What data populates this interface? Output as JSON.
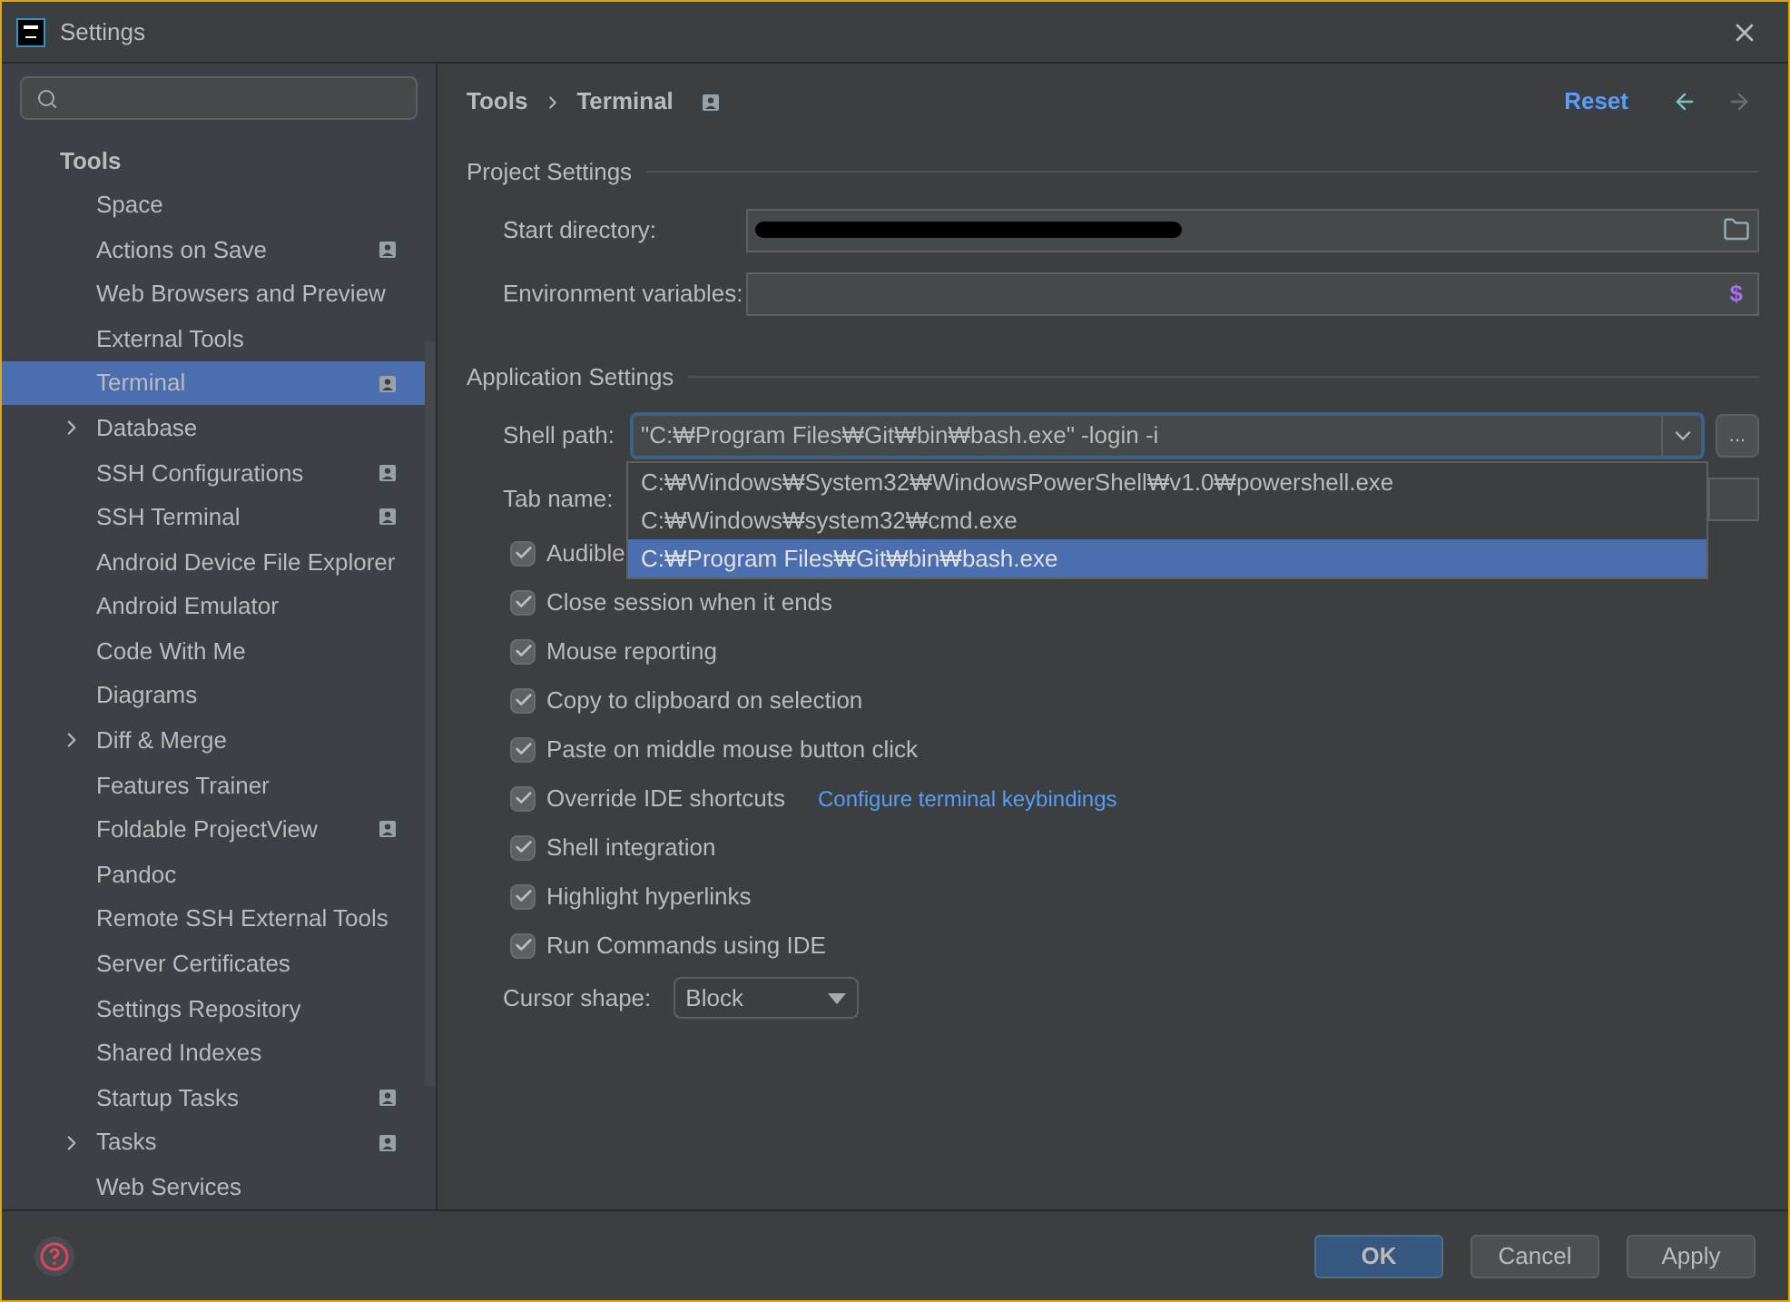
{
  "window": {
    "title": "Settings"
  },
  "sidebar": {
    "group": "Tools",
    "items": [
      {
        "label": "Space",
        "selected": false,
        "expandable": false,
        "project_level": false
      },
      {
        "label": "Actions on Save",
        "selected": false,
        "expandable": false,
        "project_level": true
      },
      {
        "label": "Web Browsers and Preview",
        "selected": false,
        "expandable": false,
        "project_level": false
      },
      {
        "label": "External Tools",
        "selected": false,
        "expandable": false,
        "project_level": false
      },
      {
        "label": "Terminal",
        "selected": true,
        "expandable": false,
        "project_level": true
      },
      {
        "label": "Database",
        "selected": false,
        "expandable": true,
        "project_level": false
      },
      {
        "label": "SSH Configurations",
        "selected": false,
        "expandable": false,
        "project_level": true
      },
      {
        "label": "SSH Terminal",
        "selected": false,
        "expandable": false,
        "project_level": true
      },
      {
        "label": "Android Device File Explorer",
        "selected": false,
        "expandable": false,
        "project_level": false
      },
      {
        "label": "Android Emulator",
        "selected": false,
        "expandable": false,
        "project_level": false
      },
      {
        "label": "Code With Me",
        "selected": false,
        "expandable": false,
        "project_level": false
      },
      {
        "label": "Diagrams",
        "selected": false,
        "expandable": false,
        "project_level": false
      },
      {
        "label": "Diff & Merge",
        "selected": false,
        "expandable": true,
        "project_level": false
      },
      {
        "label": "Features Trainer",
        "selected": false,
        "expandable": false,
        "project_level": false
      },
      {
        "label": "Foldable ProjectView",
        "selected": false,
        "expandable": false,
        "project_level": true
      },
      {
        "label": "Pandoc",
        "selected": false,
        "expandable": false,
        "project_level": false
      },
      {
        "label": "Remote SSH External Tools",
        "selected": false,
        "expandable": false,
        "project_level": false
      },
      {
        "label": "Server Certificates",
        "selected": false,
        "expandable": false,
        "project_level": false
      },
      {
        "label": "Settings Repository",
        "selected": false,
        "expandable": false,
        "project_level": false
      },
      {
        "label": "Shared Indexes",
        "selected": false,
        "expandable": false,
        "project_level": false
      },
      {
        "label": "Startup Tasks",
        "selected": false,
        "expandable": false,
        "project_level": true
      },
      {
        "label": "Tasks",
        "selected": false,
        "expandable": true,
        "project_level": true
      },
      {
        "label": "Web Services",
        "selected": false,
        "expandable": false,
        "project_level": false
      }
    ]
  },
  "breadcrumb": [
    "Tools",
    "Terminal"
  ],
  "reset": "Reset",
  "project_settings": {
    "title": "Project Settings",
    "start_directory": {
      "label": "Start directory:"
    },
    "environment_variables": {
      "label": "Environment variables:",
      "symbol": "$"
    }
  },
  "application_settings": {
    "title": "Application Settings",
    "shell_path": {
      "label": "Shell path:",
      "value": "\"C:₩Program Files₩Git₩bin₩bash.exe\" -login -i",
      "more": "...",
      "options": [
        {
          "label": "C:₩Windows₩System32₩WindowsPowerShell₩v1.0₩powershell.exe",
          "selected": false
        },
        {
          "label": "C:₩Windows₩system32₩cmd.exe",
          "selected": false
        },
        {
          "label": "C:₩Program Files₩Git₩bin₩bash.exe",
          "selected": true
        }
      ]
    },
    "tab_name": {
      "label": "Tab name:"
    },
    "checkboxes": [
      {
        "label": "Audible",
        "checked": true
      },
      {
        "label": "Close session when it ends",
        "checked": true
      },
      {
        "label": "Mouse reporting",
        "checked": true
      },
      {
        "label": "Copy to clipboard on selection",
        "checked": true
      },
      {
        "label": "Paste on middle mouse button click",
        "checked": true
      },
      {
        "label": "Override IDE shortcuts",
        "checked": true,
        "link": "Configure terminal keybindings"
      },
      {
        "label": "Shell integration",
        "checked": true
      },
      {
        "label": "Highlight hyperlinks",
        "checked": true
      },
      {
        "label": "Run Commands using IDE",
        "checked": true
      }
    ],
    "cursor_shape": {
      "label": "Cursor shape:",
      "value": "Block"
    }
  },
  "buttons": [
    {
      "label": "OK",
      "kind": "primary"
    },
    {
      "label": "Cancel",
      "kind": "normal"
    },
    {
      "label": "Apply",
      "kind": "normal"
    }
  ]
}
